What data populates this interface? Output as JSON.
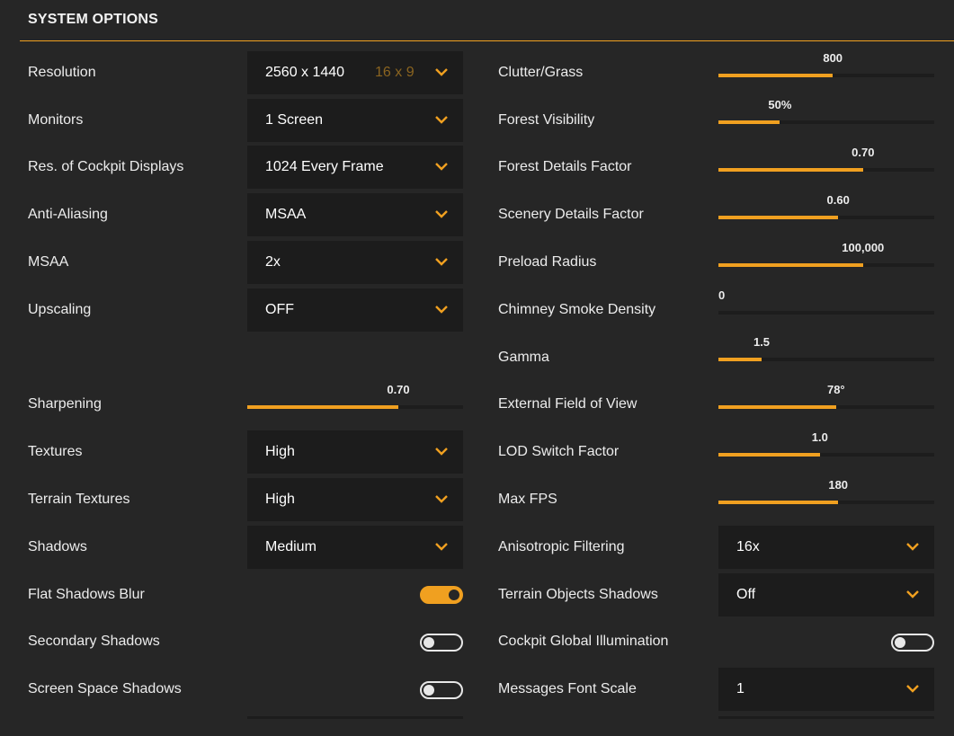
{
  "header": {
    "title": "SYSTEM OPTIONS"
  },
  "colors": {
    "accent": "#f0a020",
    "background": "#262626",
    "control": "#1c1c1c"
  },
  "left": {
    "resolution": {
      "label": "Resolution",
      "value": "2560 x 1440",
      "aspect": "16 x 9"
    },
    "monitors": {
      "label": "Monitors",
      "value": "1 Screen"
    },
    "cockpit_displays": {
      "label": "Res. of Cockpit Displays",
      "value": "1024 Every Frame"
    },
    "anti_aliasing": {
      "label": "Anti-Aliasing",
      "value": "MSAA"
    },
    "msaa": {
      "label": "MSAA",
      "value": "2x"
    },
    "upscaling": {
      "label": "Upscaling",
      "value": "OFF"
    },
    "sharpening": {
      "label": "Sharpening",
      "value": "0.70",
      "fraction": 0.7
    },
    "textures": {
      "label": "Textures",
      "value": "High"
    },
    "terrain_textures": {
      "label": "Terrain Textures",
      "value": "High"
    },
    "shadows": {
      "label": "Shadows",
      "value": "Medium"
    },
    "flat_shadows_blur": {
      "label": "Flat Shadows Blur",
      "on": true
    },
    "secondary_shadows": {
      "label": "Secondary Shadows",
      "on": false
    },
    "screen_space_shadows": {
      "label": "Screen Space Shadows",
      "on": false
    }
  },
  "right": {
    "clutter_grass": {
      "label": "Clutter/Grass",
      "value": "800",
      "fraction": 0.53
    },
    "forest_visibility": {
      "label": "Forest Visibility",
      "value": "50%",
      "fraction": 0.285
    },
    "forest_details": {
      "label": "Forest Details Factor",
      "value": "0.70",
      "fraction": 0.67
    },
    "scenery_details": {
      "label": "Scenery Details Factor",
      "value": "0.60",
      "fraction": 0.555
    },
    "preload_radius": {
      "label": "Preload Radius",
      "value": "100,000",
      "fraction": 0.67
    },
    "chimney_smoke": {
      "label": "Chimney Smoke Density",
      "value": "0",
      "fraction": 0.0
    },
    "gamma": {
      "label": "Gamma",
      "value": "1.5",
      "fraction": 0.2
    },
    "external_fov": {
      "label": "External Field of View",
      "value": "78°",
      "fraction": 0.545
    },
    "lod_switch": {
      "label": "LOD Switch Factor",
      "value": "1.0",
      "fraction": 0.47
    },
    "max_fps": {
      "label": "Max FPS",
      "value": "180",
      "fraction": 0.555
    },
    "anisotropic": {
      "label": "Anisotropic Filtering",
      "value": "16x"
    },
    "terrain_objects_shadows": {
      "label": "Terrain Objects Shadows",
      "value": "Off"
    },
    "cockpit_gi": {
      "label": "Cockpit Global Illumination",
      "on": false
    },
    "messages_font_scale": {
      "label": "Messages Font Scale",
      "value": "1"
    }
  },
  "icons": {
    "dropdown": "chevron-down-icon"
  }
}
